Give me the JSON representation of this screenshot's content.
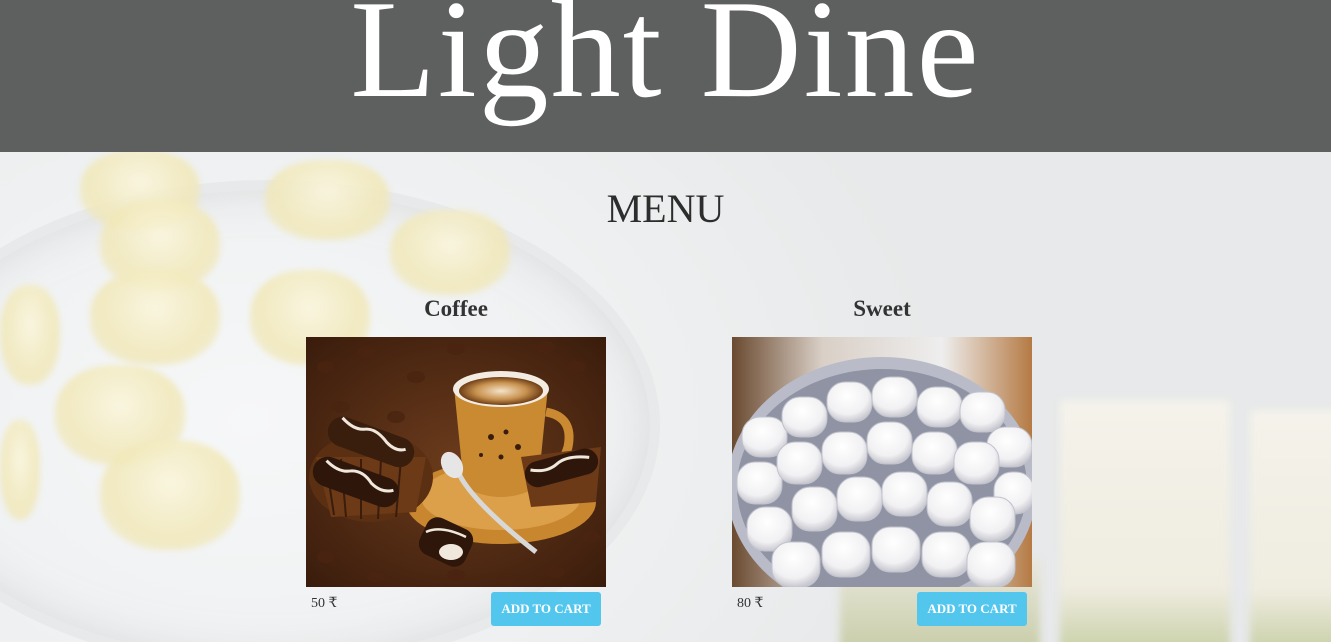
{
  "brand": "Light Dine",
  "menu_title": "MENU",
  "items": [
    {
      "name": "Coffee",
      "price": "50 ₹",
      "button_label": "ADD TO CART"
    },
    {
      "name": "Sweet",
      "price": "80 ₹",
      "button_label": "ADD TO CART"
    }
  ],
  "colors": {
    "header_bg": "#5e605f",
    "button_bg": "#53c6ee",
    "page_bg": "#eceeef"
  }
}
